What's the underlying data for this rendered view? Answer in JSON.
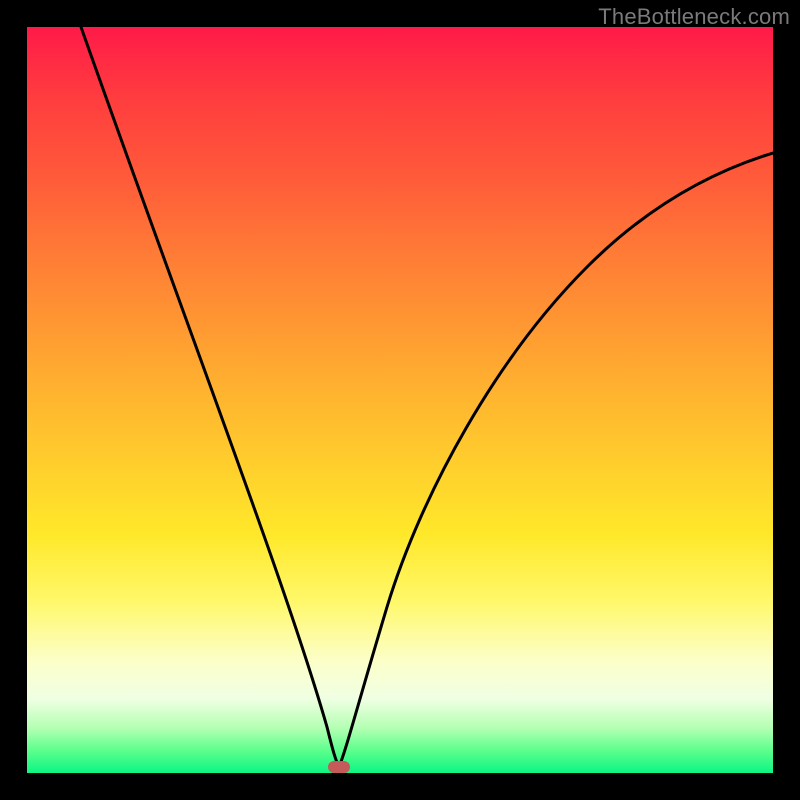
{
  "watermark": "TheBottleneck.com",
  "chart_data": {
    "type": "line",
    "title": "",
    "xlabel": "",
    "ylabel": "",
    "xlim": [
      0,
      100
    ],
    "ylim": [
      0,
      100
    ],
    "grid": false,
    "legend": null,
    "series": [
      {
        "name": "left-branch",
        "x": [
          0,
          5,
          10,
          15,
          20,
          25,
          30,
          35,
          38,
          40,
          41,
          41.8
        ],
        "values": [
          100,
          88,
          76,
          64,
          52,
          40,
          29,
          18,
          11,
          6,
          3,
          0
        ]
      },
      {
        "name": "right-branch",
        "x": [
          41.8,
          43,
          45,
          48,
          52,
          57,
          63,
          70,
          78,
          86,
          94,
          100
        ],
        "values": [
          0,
          6,
          16,
          28,
          40,
          50,
          58,
          65,
          71,
          76,
          80,
          83
        ]
      }
    ],
    "marker": {
      "x": 41.8,
      "y": 0,
      "color": "#c45a5a"
    },
    "gradient_stops": [
      {
        "pos": 0,
        "color": "#ff1a49"
      },
      {
        "pos": 50,
        "color": "#ffd22c"
      },
      {
        "pos": 85,
        "color": "#fcffc9"
      },
      {
        "pos": 100,
        "color": "#0cf584"
      }
    ]
  }
}
